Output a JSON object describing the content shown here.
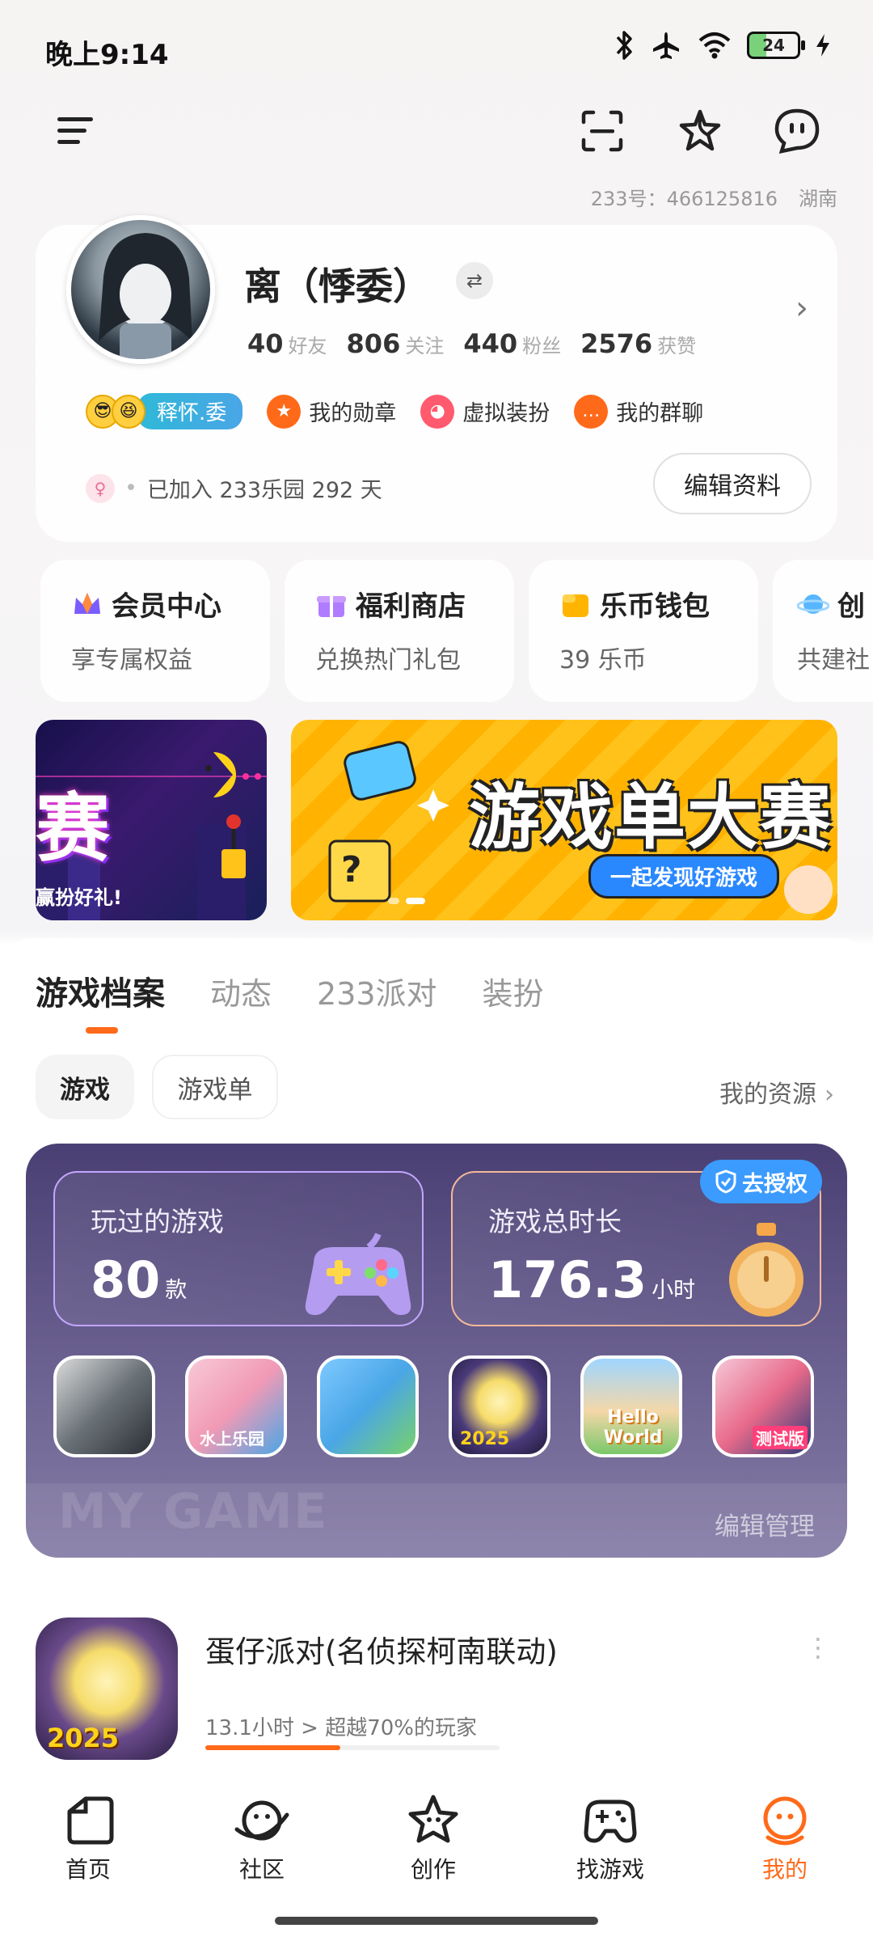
{
  "status_bar": {
    "time": "晚上9:14",
    "battery": "24"
  },
  "account": {
    "id": "233号：466125816",
    "region": "湖南"
  },
  "profile": {
    "username": "离（悸委）",
    "switch_symbol": "⇄",
    "stats": [
      {
        "value": "40",
        "label": "好友"
      },
      {
        "value": "806",
        "label": "关注"
      },
      {
        "value": "440",
        "label": "粉丝"
      },
      {
        "value": "2576",
        "label": "获赞"
      }
    ],
    "badge_name": "释怀.委",
    "quick_links": [
      {
        "label": "我的勋章",
        "icon": "medal-icon",
        "color": "#ff6a1a"
      },
      {
        "label": "虚拟装扮",
        "icon": "cat-costume-icon",
        "color": "#ff5a6e"
      },
      {
        "label": "我的群聊",
        "icon": "group-chat-icon",
        "color": "#ff6a1a"
      }
    ],
    "joined_text": "已加入 233乐园 292 天",
    "edit_button": "编辑资料"
  },
  "services": [
    {
      "title": "会员中心",
      "subtitle": "享专属权益",
      "icon": "crown-icon"
    },
    {
      "title": "福利商店",
      "subtitle": "兑换热门礼包",
      "icon": "gift-icon"
    },
    {
      "title": "乐币钱包",
      "subtitle": "39 乐币",
      "icon": "wallet-icon"
    },
    {
      "title": "创",
      "subtitle": "共建社",
      "icon": "planet-icon"
    }
  ],
  "banners": {
    "small_title": "赛",
    "small_sub": "赢扮好礼!",
    "big_title": "游戏单大赛",
    "big_sub": "一起发现好游戏"
  },
  "tabs": [
    "游戏档案",
    "动态",
    "233派对",
    "装扮"
  ],
  "chips": {
    "active": "游戏",
    "inactive": "游戏单"
  },
  "resources_link": "我的资源",
  "game_panel": {
    "played": {
      "title": "玩过的游戏",
      "value": "80",
      "unit": "款"
    },
    "duration": {
      "title": "游戏总时长",
      "value": "176.3",
      "unit": "小时"
    },
    "authorize": "去授权",
    "bg_text": "MY GAME",
    "edit_manage": "编辑管理",
    "thumb_labels": [
      "",
      "水上乐园",
      "",
      "2025",
      "Hello World",
      "测试版"
    ]
  },
  "recent_game": {
    "title": "蛋仔派对(名侦探柯南联动)",
    "subtitle": "13.1小时 > 超越70%的玩家",
    "progress": 0.46,
    "icon_label": "2025"
  },
  "bottom_nav": [
    {
      "label": "首页",
      "icon": "home-icon"
    },
    {
      "label": "社区",
      "icon": "community-planet-icon"
    },
    {
      "label": "创作",
      "icon": "create-star-icon"
    },
    {
      "label": "找游戏",
      "icon": "gamepad-icon"
    },
    {
      "label": "我的",
      "icon": "profile-icon"
    }
  ]
}
